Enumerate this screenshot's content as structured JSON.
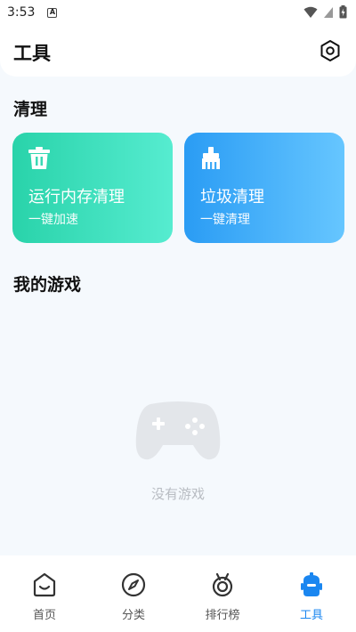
{
  "status": {
    "time": "3:53",
    "notif_icon": "a-icon"
  },
  "header": {
    "title": "工具",
    "settings_icon": "settings-hex-icon"
  },
  "cleanup": {
    "section_title": "清理",
    "cards": [
      {
        "title": "运行内存清理",
        "subtitle": "一键加速",
        "icon": "trash-icon",
        "color_from": "#29d3aa",
        "color_to": "#56ecd0"
      },
      {
        "title": "垃圾清理",
        "subtitle": "一键清理",
        "icon": "broom-icon",
        "color_from": "#2a9cf4",
        "color_to": "#66c6ff"
      }
    ]
  },
  "games": {
    "section_title": "我的游戏",
    "empty_text": "没有游戏",
    "empty_icon": "gamepad-icon"
  },
  "tabbar": {
    "active_color": "#1a86f0",
    "tabs": [
      {
        "label": "首页",
        "icon": "home-icon"
      },
      {
        "label": "分类",
        "icon": "compass-icon"
      },
      {
        "label": "排行榜",
        "icon": "medal-icon"
      },
      {
        "label": "工具",
        "icon": "robot-icon",
        "active": true
      }
    ]
  }
}
